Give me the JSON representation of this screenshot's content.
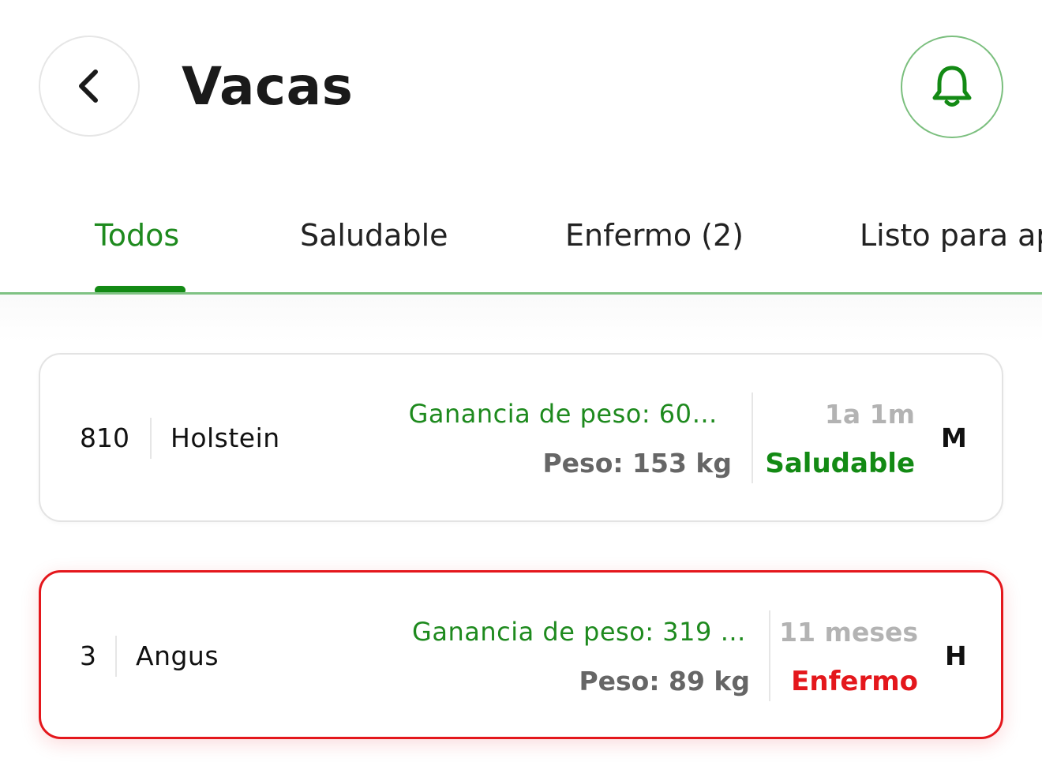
{
  "header": {
    "title": "Vacas",
    "back_icon": "chevron-left-icon",
    "bell_icon": "bell-icon"
  },
  "colors": {
    "accent": "#138a14",
    "danger": "#e4171c"
  },
  "tabs": [
    {
      "label": "Todos",
      "active": true
    },
    {
      "label": "Saludable",
      "active": false
    },
    {
      "label": "Enfermo (2)",
      "active": false
    },
    {
      "label": "Listo para ap",
      "active": false
    }
  ],
  "cows": [
    {
      "id": "810",
      "breed": "Holstein",
      "gain": "Ganancia de peso: 60…",
      "weight": "Peso: 153 kg",
      "age": "1a 1m",
      "status": "Saludable",
      "sex": "M"
    },
    {
      "id": "3",
      "breed": "Angus",
      "gain": "Ganancia de peso: 319 …",
      "weight": "Peso: 89 kg",
      "age": "11 meses",
      "status": "Enfermo",
      "sex": "H"
    }
  ]
}
